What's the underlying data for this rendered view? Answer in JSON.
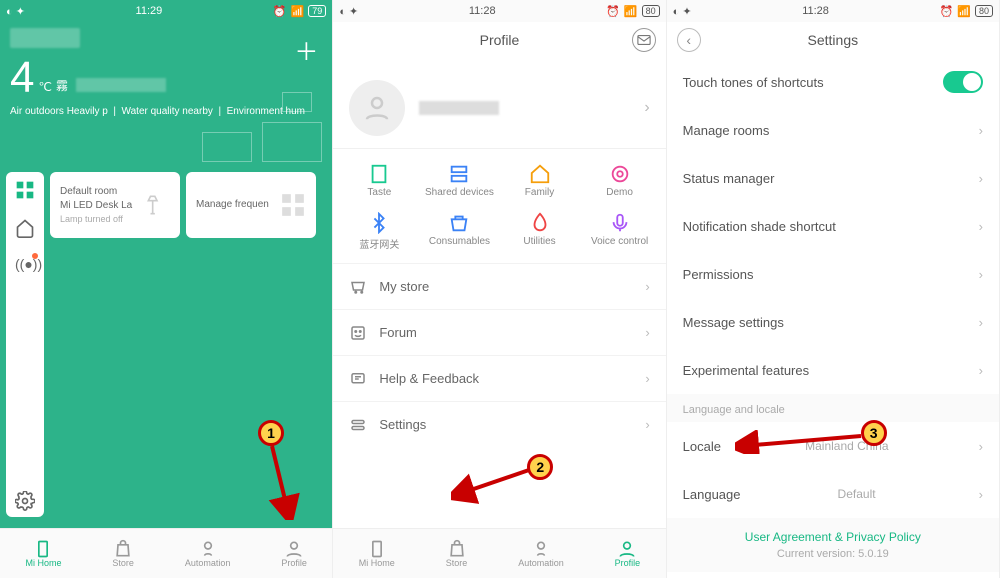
{
  "statusbar": {
    "time1": "11:29",
    "time2": "11:28",
    "time3": "11:28",
    "battery1": "79",
    "battery2": "80",
    "battery3": "80"
  },
  "screen1": {
    "temp_value": "4",
    "temp_unit": "℃",
    "weather_char": "霧",
    "infoline_a": "Air outdoors Heavily p",
    "infoline_b": "Water quality nearby",
    "infoline_c": "Environment hum",
    "card1_title": "Default room",
    "card1_sub": "Mi LED Desk La",
    "card1_status": "Lamp turned off",
    "card2_title": "Manage frequen"
  },
  "bottomnav": {
    "mihome": "Mi Home",
    "store": "Store",
    "automation": "Automation",
    "profile": "Profile"
  },
  "screen2": {
    "title": "Profile",
    "features": {
      "taste": "Taste",
      "shared": "Shared devices",
      "family": "Family",
      "demo": "Demo",
      "bt": "蓝牙网关",
      "consumables": "Consumables",
      "utilities": "Utilities",
      "voice": "Voice control"
    },
    "menu": {
      "mystore": "My store",
      "forum": "Forum",
      "help": "Help & Feedback",
      "settings": "Settings"
    }
  },
  "screen3": {
    "title": "Settings",
    "touch_tones": "Touch tones of shortcuts",
    "manage_rooms": "Manage rooms",
    "status_manager": "Status manager",
    "notif_shortcut": "Notification shade shortcut",
    "permissions": "Permissions",
    "message_settings": "Message settings",
    "experimental": "Experimental features",
    "section_locale": "Language and locale",
    "locale": "Locale",
    "locale_value": "Mainland China",
    "language": "Language",
    "language_value": "Default",
    "footer_link": "User Agreement & Privacy Policy",
    "footer_version": "Current version: 5.0.19"
  },
  "annotations": {
    "step1": "1",
    "step2": "2",
    "step3": "3"
  }
}
